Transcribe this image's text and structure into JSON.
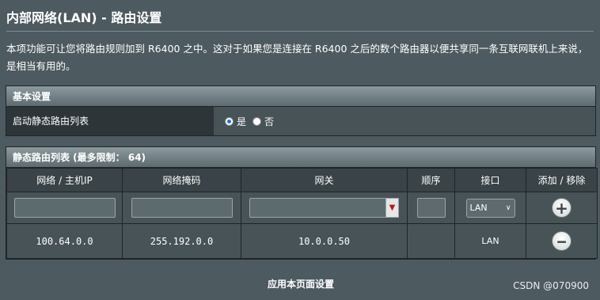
{
  "page": {
    "title": "内部网络(LAN) - 路由设置",
    "description": "本项功能可让您将路由规则加到 R6400 之中。这对于如果您是连接在 R6400 之后的数个路由器以便共享同一条互联网联机上来说，是相当有用的。"
  },
  "basic": {
    "header": "基本设置",
    "enable_label": "启动静态路由列表",
    "option_yes": "是",
    "option_no": "否",
    "selected": "是"
  },
  "route_list": {
    "header": "静态路由列表 (最多限制： 64)",
    "columns": [
      "网络 / 主机IP",
      "网络掩码",
      "网关",
      "顺序",
      "接口",
      "添加 / 移除"
    ],
    "input_row": {
      "network": "",
      "netmask": "",
      "gateway": "",
      "metric": "",
      "interface": "LAN"
    },
    "rows": [
      {
        "network": "100.64.0.0",
        "netmask": "255.192.0.0",
        "gateway": "10.0.0.50",
        "metric": "",
        "interface": "LAN"
      }
    ]
  },
  "actions": {
    "apply": "应用本页面设置"
  },
  "watermark": "CSDN @070900",
  "icons": {
    "add": "plus-circle-icon",
    "remove": "minus-circle-icon",
    "dropdown": "triangle-down-icon"
  }
}
